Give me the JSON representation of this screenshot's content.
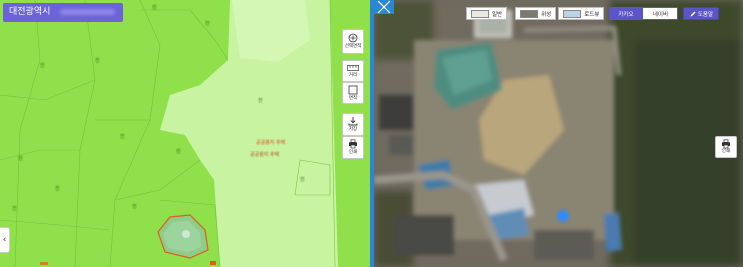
{
  "left_map": {
    "address_label": "대전광역시",
    "parcel_labels": [
      "전",
      "전",
      "전",
      "전",
      "전",
      "전",
      "전",
      "전",
      "전",
      "전",
      "전",
      "전"
    ],
    "highlight_labels": [
      "공공용지 주택",
      "공공용지 주택"
    ],
    "tools": [
      {
        "id": "zoom-area",
        "label": "선택면적",
        "icon": "circle-plus-icon"
      },
      {
        "id": "distance",
        "label": "거리",
        "icon": "ruler-icon"
      },
      {
        "id": "area",
        "label": "면적",
        "icon": "square-icon"
      },
      {
        "id": "save",
        "label": "저장",
        "icon": "download-icon"
      },
      {
        "id": "print",
        "label": "인쇄",
        "icon": "printer-icon"
      }
    ],
    "collapse_glyph": "‹"
  },
  "right_map": {
    "map_types": [
      {
        "label": "일반"
      },
      {
        "label": "위성"
      },
      {
        "label": "로드뷰"
      }
    ],
    "providers": [
      {
        "label": "카카오",
        "active": true
      },
      {
        "label": "네이버",
        "active": false
      }
    ],
    "tool_label": "도움말",
    "print_label": "인쇄"
  },
  "colors": {
    "accent_blue": "#2b86d6",
    "brand_purple": "#5b55c7",
    "parcel_green": "#8fe04a",
    "light_green": "#c5f29a"
  }
}
